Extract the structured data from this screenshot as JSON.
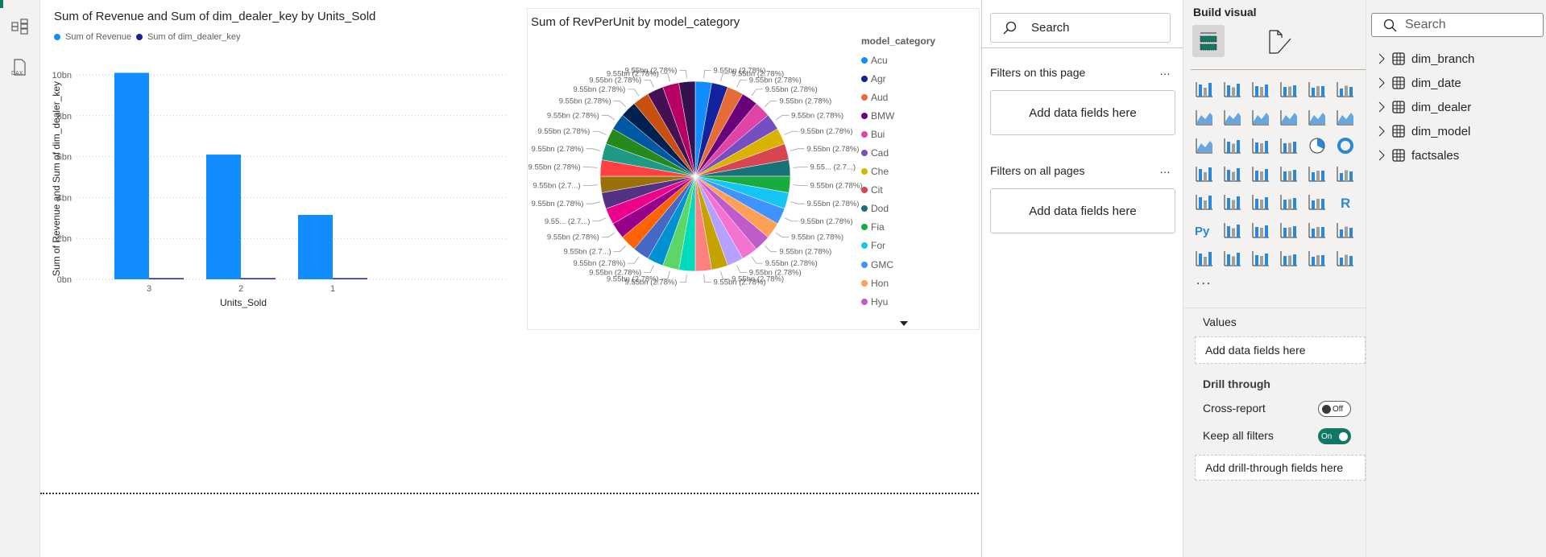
{
  "rail": {
    "icons": [
      "model-view-icon",
      "dax-query-icon"
    ]
  },
  "bar_visual": {
    "title": "Sum of Revenue and Sum of dim_dealer_key by Units_Sold",
    "legend": [
      {
        "label": "Sum of Revenue",
        "color": "#118DFF"
      },
      {
        "label": "Sum of dim_dealer_key",
        "color": "#12239E"
      }
    ]
  },
  "pie_visual": {
    "title": "Sum of RevPerUnit by model_category",
    "legend_title": "model_category"
  },
  "chart_data": [
    {
      "type": "bar",
      "title": "Sum of Revenue and Sum of dim_dealer_key by Units_Sold",
      "xlabel": "Units_Sold",
      "ylabel": "Sum of Revenue and Sum of dim_dealer_key",
      "categories": [
        "3",
        "2",
        "1"
      ],
      "series": [
        {
          "name": "Sum of Revenue",
          "color": "#118DFF",
          "values": [
            10.1,
            6.1,
            3.15
          ]
        },
        {
          "name": "Sum of dim_dealer_key",
          "color": "#12239E",
          "values": [
            0.05,
            0.05,
            0.05
          ]
        }
      ],
      "yticks": [
        "0bn",
        "2bn",
        "4bn",
        "6bn",
        "8bn",
        "10bn"
      ],
      "ylim": [
        0,
        10
      ],
      "unit": "bn",
      "grid": true,
      "legend_placement": "top-left"
    },
    {
      "type": "pie",
      "title": "Sum of RevPerUnit by model_category",
      "legend_title": "model_category",
      "legend_placement": "right",
      "legend_entries": [
        "Acu",
        "Agr",
        "Aud",
        "BMW",
        "Bui",
        "Cad",
        "Che",
        "Cit",
        "Dod",
        "Fia",
        "For",
        "GMC",
        "Hon",
        "Hyu"
      ],
      "slice_count": 36,
      "values": [
        9.55,
        9.55,
        9.55,
        9.55,
        9.55,
        9.55,
        9.55,
        9.55,
        9.55,
        9.55,
        9.55,
        9.55,
        9.55,
        9.55,
        9.55,
        9.55,
        9.55,
        9.55,
        9.55,
        9.55,
        9.55,
        9.55,
        9.55,
        9.55,
        9.55,
        9.55,
        9.55,
        9.55,
        9.55,
        9.55,
        9.55,
        9.55,
        9.55,
        9.55,
        9.55,
        9.55
      ],
      "labels": [
        "9.55bn (2.78%)",
        "9.55bn (2.78%)",
        "9.55bn (2.78%)",
        "9.55bn (2.78%)",
        "9.55bn (2.78%)",
        "9.55bn (2.78%)",
        "9.55bn (2.78%)",
        "9.55bn (2.78%)",
        "9.55... (2.7...)",
        "9.55bn (2.78%)",
        "9.55bn (2.78%)",
        "9.55bn (2.78%)",
        "9.55bn (2.78%)",
        "9.55bn (2.78%)",
        "9.55bn (2.78%)",
        "9.55bn (2.78%)",
        "9.55bn (2.78%)",
        "9.55bn (2.78%)",
        "9.55bn (2.78%)",
        "9.55bn (2.78%)",
        "9.55bn (2.78%)",
        "9.55bn (2.78%)",
        "9.55bn (2.7...)",
        "9.55bn (2.78%)",
        "9.55... (2.7...)",
        "9.55bn (2.78%)",
        "9.55bn (2.7...)",
        "9.55bn (2.78%)",
        "9.55bn (2.78%)",
        "9.55bn (2.78%)",
        "9.55bn (2.78%)",
        "9.55bn (2.78%)",
        "9.55bn (2.78%)",
        "9.55bn (2.78%)",
        "9.55bn (2.78%)",
        "9.55bn (2.78%)"
      ],
      "colors": [
        "#118DFF",
        "#12239E",
        "#E66C37",
        "#6B007B",
        "#E044A7",
        "#744EC2",
        "#D9B300",
        "#D64550",
        "#197278",
        "#1AAB40",
        "#15C6F4",
        "#4092FF",
        "#FFA058",
        "#BE5DC9",
        "#F472D0",
        "#B5A1FF",
        "#C4A200",
        "#FD8080",
        "#00DBBC",
        "#5BD667",
        "#0091D5",
        "#4668C5",
        "#FF6300",
        "#99008A",
        "#EC008C",
        "#533285",
        "#99700A",
        "#FF4141",
        "#1F9A85",
        "#25891C",
        "#0057A2",
        "#002050",
        "#C94F0F",
        "#450F54",
        "#B60064",
        "#34124F"
      ]
    }
  ],
  "filters": {
    "search_placeholder": "Search",
    "this_page": "Filters on this page",
    "all_pages": "Filters on all pages",
    "more": "…",
    "add_fields": "Add data fields here"
  },
  "build": {
    "title": "Build visual",
    "more": "...",
    "visual_icons": [
      "stacked-bar-chart-icon",
      "stacked-column-chart-icon",
      "clustered-bar-chart-icon",
      "clustered-column-chart-icon",
      "100-stacked-bar-chart-icon",
      "100-stacked-column-chart-icon",
      "line-chart-icon",
      "area-chart-icon",
      "stacked-area-chart-icon",
      "100-stacked-area-chart-icon",
      "line-stacked-column-chart-icon",
      "line-clustered-column-chart-icon",
      "ribbon-chart-icon",
      "waterfall-chart-icon",
      "funnel-icon",
      "scatter-chart-icon",
      "pie-chart-icon",
      "donut-chart-icon",
      "treemap-icon",
      "map-icon",
      "filled-map-icon",
      "azure-map-icon",
      "gauge-icon",
      "card-icon",
      "multi-row-card-icon",
      "kpi-icon",
      "slicer-icon",
      "table-icon",
      "matrix-icon",
      "r-visual-icon",
      "python-visual-icon",
      "key-influencers-icon",
      "decomposition-tree-icon",
      "qa-icon",
      "narrative-icon",
      "goals-icon",
      "paginated-report-icon",
      "new-card-icon",
      "new-slicer-icon",
      "azure-map-2-icon",
      "power-apps-icon",
      "power-automate-icon"
    ],
    "values_label": "Values",
    "add_fields": "Add data fields here",
    "drill_through": "Drill through",
    "cross_report": "Cross-report",
    "cross_report_state": "Off",
    "keep_filters": "Keep all filters",
    "keep_filters_state": "On",
    "add_drill": "Add drill-through fields here",
    "accent": "#117865"
  },
  "data_pane": {
    "search_placeholder": "Search",
    "tables": [
      "dim_branch",
      "dim_date",
      "dim_dealer",
      "dim_model",
      "factsales"
    ]
  }
}
